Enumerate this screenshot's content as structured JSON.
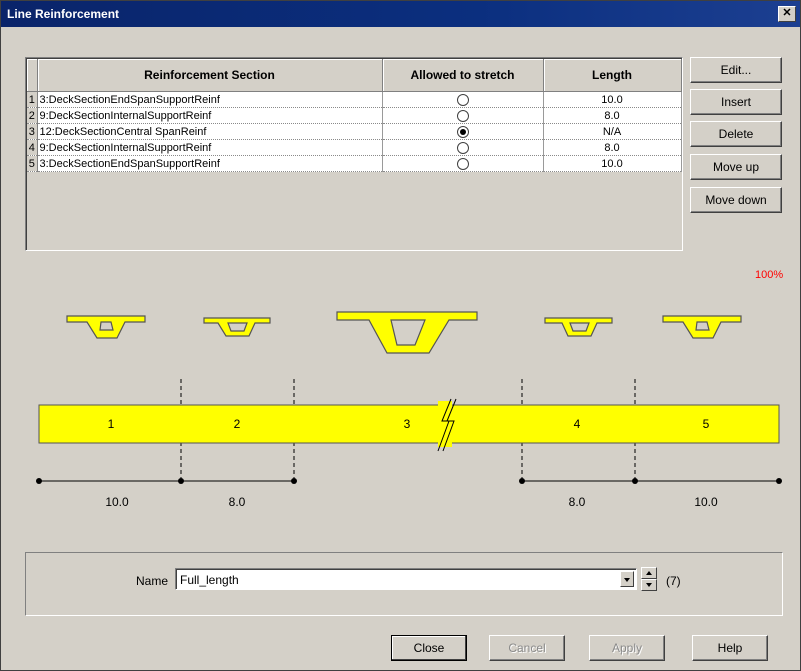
{
  "window": {
    "title": "Line Reinforcement",
    "close_glyph": "✕"
  },
  "table": {
    "headers": [
      "",
      "Reinforcement Section",
      "Allowed to stretch",
      "Length"
    ],
    "rows": [
      {
        "num": "1",
        "section": "3:DeckSectionEndSpanSupportReinf",
        "stretch": false,
        "length": "10.0"
      },
      {
        "num": "2",
        "section": "9:DeckSectionInternalSupportReinf",
        "stretch": false,
        "length": "8.0"
      },
      {
        "num": "3",
        "section": "12:DeckSectionCentral SpanReinf",
        "stretch": true,
        "length": "N/A"
      },
      {
        "num": "4",
        "section": "9:DeckSectionInternalSupportReinf",
        "stretch": false,
        "length": "8.0"
      },
      {
        "num": "5",
        "section": "3:DeckSectionEndSpanSupportReinf",
        "stretch": false,
        "length": "10.0"
      }
    ]
  },
  "side_buttons": {
    "edit": "Edit...",
    "insert": "Insert",
    "delete": "Delete",
    "move_up": "Move up",
    "move_down": "Move down"
  },
  "zoom_label": "100%",
  "diagram": {
    "segments": [
      "1",
      "2",
      "3",
      "4",
      "5"
    ],
    "dimensions": [
      "10.0",
      "8.0",
      "8.0",
      "10.0"
    ],
    "fill_color": "#ffff00",
    "break_symbol": "double-slash-break-icon"
  },
  "name_field": {
    "label": "Name",
    "value": "Full_length",
    "count": "(7)"
  },
  "bottom_buttons": {
    "close": "Close",
    "cancel": "Cancel",
    "apply": "Apply",
    "help": "Help"
  }
}
